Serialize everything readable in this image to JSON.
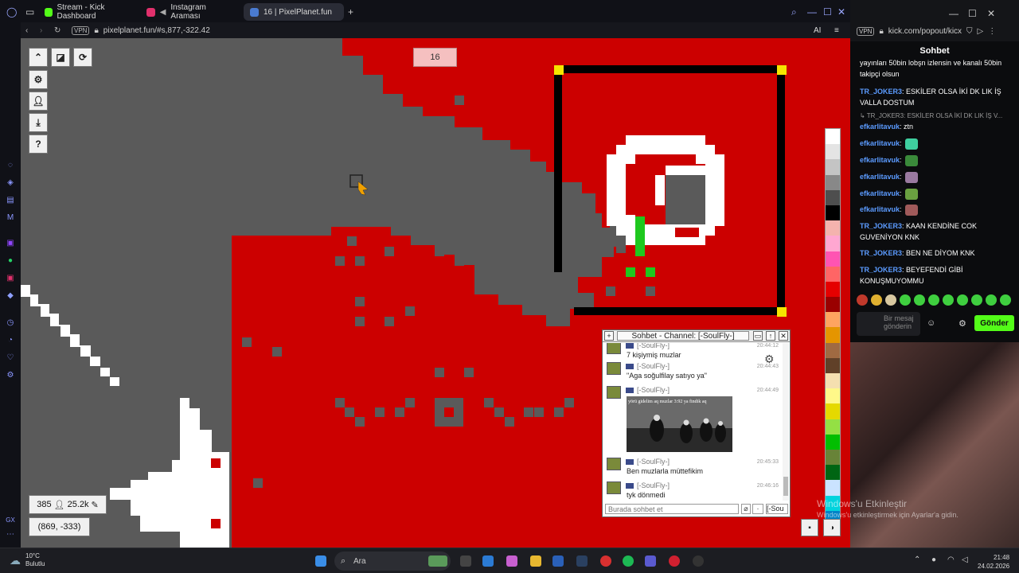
{
  "browser": {
    "tabs": [
      {
        "label": "Stream - Kick Dashboard",
        "icon": "kick-icon",
        "color": "#53fc18"
      },
      {
        "label": "Instagram Araması",
        "icon": "instagram-icon",
        "color": "#e1306c"
      },
      {
        "label": "16 | PixelPlanet.fun",
        "icon": "pixelplanet-icon",
        "color": "#4a7bd0"
      }
    ],
    "address": "pixelplanet.fun/#s,877,-322.42",
    "vpn_label": "VPN",
    "ai_label": "AI"
  },
  "pixelplanet": {
    "badge": "16",
    "online_count": "385",
    "pixels_count": "25.2k",
    "coords": "(869, -333)"
  },
  "game_chat": {
    "title": "Sohbet - Channel: [-SoulFly-]",
    "input_placeholder": "Burada sohbet et",
    "channel_short": "[-Sou",
    "messages": [
      {
        "name": "[-SoulFly-]",
        "time": "20:44:12",
        "text": "7 kişiymiş muzlar"
      },
      {
        "name": "[-SoulFly-]",
        "time": "20:44:43",
        "text": "\"Aga soğulfilay satıyo ya\""
      },
      {
        "name": "[-SoulFly-]",
        "time": "20:44:49",
        "text": "",
        "image_caption": "yörü gidelim aq     muzlar      3:92 ya findik aq"
      },
      {
        "name": "[-SoulFly-]",
        "time": "20:45:33",
        "text": "Ben muzlarla müttefikim"
      },
      {
        "name": "[-SoulFly-]",
        "time": "20:46:16",
        "text": "tyk dönmedi"
      }
    ]
  },
  "kick": {
    "url": "kick.com/popout/kicx",
    "vpn_label": "VPN",
    "title": "Sohbet",
    "messages": [
      {
        "user": "",
        "text": "yayınları 50bin lobşn izlensin ve kanalı 50bin takipçi olsun",
        "reply": ""
      },
      {
        "user": "TR_JOKER3",
        "text": "ESKİLER OLSA İKİ DK LIK İŞ VALLA DOSTUM",
        "reply": ""
      },
      {
        "user": "efkarlitavuk",
        "text": "ztn",
        "reply": "TR_JOKER3: ESKİLER OLSA İKİ DK LIK İŞ V..."
      },
      {
        "user": "efkarlitavuk",
        "text": "",
        "reply": ""
      },
      {
        "user": "efkarlitavuk",
        "text": "",
        "reply": ""
      },
      {
        "user": "efkarlitavuk",
        "text": "",
        "reply": ""
      },
      {
        "user": "efkarlitavuk",
        "text": "",
        "reply": ""
      },
      {
        "user": "efkarlitavuk",
        "text": "",
        "reply": ""
      },
      {
        "user": "TR_JOKER3",
        "text": "KAAN KENDİNE COK GUVENİYON KNK",
        "reply": ""
      },
      {
        "user": "TR_JOKER3",
        "text": "BEN NE DİYOM KNK",
        "reply": ""
      },
      {
        "user": "TR_JOKER3",
        "text": "BEYEFENDİ GİBİ KONUŞMUYOMMU",
        "reply": ""
      }
    ],
    "input_placeholder": "Bir mesaj gönderin",
    "send_label": "Gönder",
    "watermark_title": "Windows'u Etkinleştir",
    "watermark_sub": "Windows'u etkinleştirmek için Ayarlar'a gidin."
  },
  "taskbar": {
    "temperature": "10°C",
    "weather": "Bulutlu",
    "search_placeholder": "Ara",
    "time": "21:48",
    "date": "24.02.2026"
  },
  "colors": {
    "red": "#cc0000",
    "gray": "#5a5a5a",
    "kick_green": "#53fc18",
    "yellow": "#f5e400"
  },
  "palette": [
    "#ffffff",
    "#e4e4e4",
    "#c4c4c4",
    "#888888",
    "#4e4e4e",
    "#000000",
    "#f4b3ae",
    "#ffa7d1",
    "#ff54b2",
    "#ff6565",
    "#e50000",
    "#9a0000",
    "#fea460",
    "#e59500",
    "#a06a42",
    "#604028",
    "#f5dfb0",
    "#fff889",
    "#e5d900",
    "#94e044",
    "#02be01",
    "#688338",
    "#006513",
    "#cae3ff",
    "#00d3dd",
    "#0083c7",
    "#0000ea",
    "#191973",
    "#cf6ee4",
    "#820080"
  ]
}
